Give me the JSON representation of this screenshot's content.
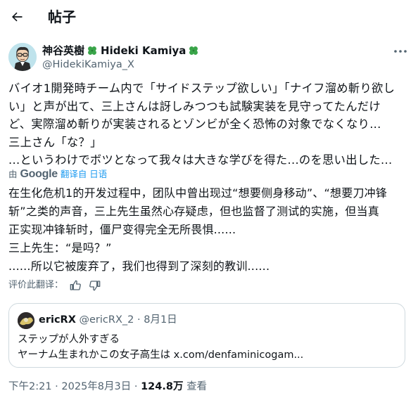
{
  "header": {
    "title": "帖子"
  },
  "post": {
    "author_jp": "神谷英樹",
    "author_en": "Hideki Kamiya",
    "handle": "@HidekiKamiya_X",
    "original_text": "バイオ1開発時チーム内で「サイドステップ欲しい」「ナイフ溜め斬り欲し\nい」と声が出て、三上さんは訝しみつつも試験実装を見守ってたんだけ\nど、実際溜め斬りが実装されるとゾンビが全く恐怖の対象でなくなり...\n三上さん「な？」\n...というわけでボツとなって我々は大きな学びを得た...のを思い出した...",
    "translated_by": "由",
    "translator": "Google",
    "translated_from": "翻译自 日语",
    "translated_text": "在生化危机1的开发过程中，团队中曾出现过“想要侧身移动”、“想要刀冲锋\n斩”之类的声音，三上先生虽然心存疑虑，但也监督了测试的实施，但当真\n正实现冲锋斩时，僵尸变得完全无所畏惧......\n三上先生：“是吗？”\n......所以它被废弃了，我们也得到了深刻的教训......",
    "rate_label": "评价此翻译："
  },
  "quote": {
    "name": "ericRX",
    "handle": "@ericRX_2",
    "separator": "·",
    "date": "8月1日",
    "text": "ステップが人外すぎる\nヤーナム生まれかこの女子高生は x.com/denfaminicogam..."
  },
  "footer": {
    "time": "下午2:21",
    "separator": "·",
    "date": "2025年8月3日",
    "views_count": "124.8万",
    "views_label": "查看"
  },
  "colors": {
    "accent": "#1d9bf0",
    "clover": "#3aa54a",
    "muted": "#536471",
    "border": "#cfd9de"
  }
}
